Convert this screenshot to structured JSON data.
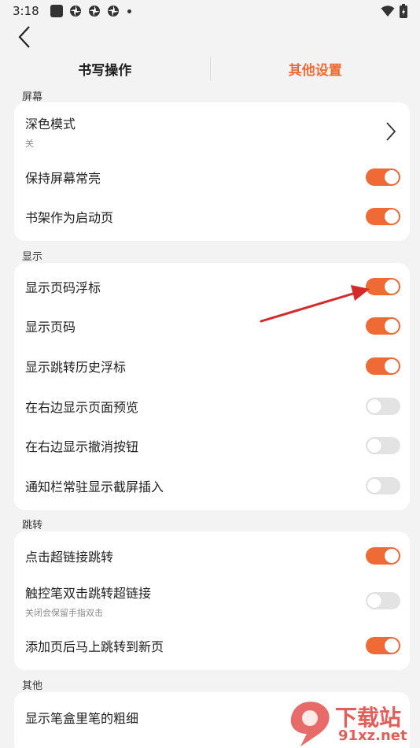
{
  "status_bar": {
    "time": "3:18"
  },
  "tabs": [
    {
      "label": "书写操作",
      "active": false
    },
    {
      "label": "其他设置",
      "active": true
    }
  ],
  "sections": {
    "screen": {
      "label": "屏幕",
      "items": [
        {
          "title": "深色模式",
          "subtitle": "关",
          "control": "chevron"
        },
        {
          "title": "保持屏幕常亮",
          "control": "toggle",
          "on": true
        },
        {
          "title": "书架作为启动页",
          "control": "toggle",
          "on": true
        }
      ]
    },
    "display": {
      "label": "显示",
      "items": [
        {
          "title": "显示页码浮标",
          "control": "toggle",
          "on": true
        },
        {
          "title": "显示页码",
          "control": "toggle",
          "on": true
        },
        {
          "title": "显示跳转历史浮标",
          "control": "toggle",
          "on": true
        },
        {
          "title": "在右边显示页面预览",
          "control": "toggle",
          "on": false
        },
        {
          "title": "在右边显示撤消按钮",
          "control": "toggle",
          "on": false
        },
        {
          "title": "通知栏常驻显示截屏插入",
          "control": "toggle",
          "on": false
        }
      ]
    },
    "jump": {
      "label": "跳转",
      "items": [
        {
          "title": "点击超链接跳转",
          "control": "toggle",
          "on": true
        },
        {
          "title": "触控笔双击跳转超链接",
          "subtitle": "关闭会保留手指双击",
          "control": "toggle",
          "on": false
        },
        {
          "title": "添加页后马上跳转到新页",
          "control": "toggle",
          "on": true
        }
      ]
    },
    "other": {
      "label": "其他",
      "items": [
        {
          "title": "显示笔盒里笔的粗细"
        }
      ]
    }
  },
  "watermark": {
    "text_cn": "下载站",
    "text_url": "91xz.net"
  },
  "colors": {
    "accent": "#f06a35",
    "annotation_arrow": "#d42a2a"
  }
}
